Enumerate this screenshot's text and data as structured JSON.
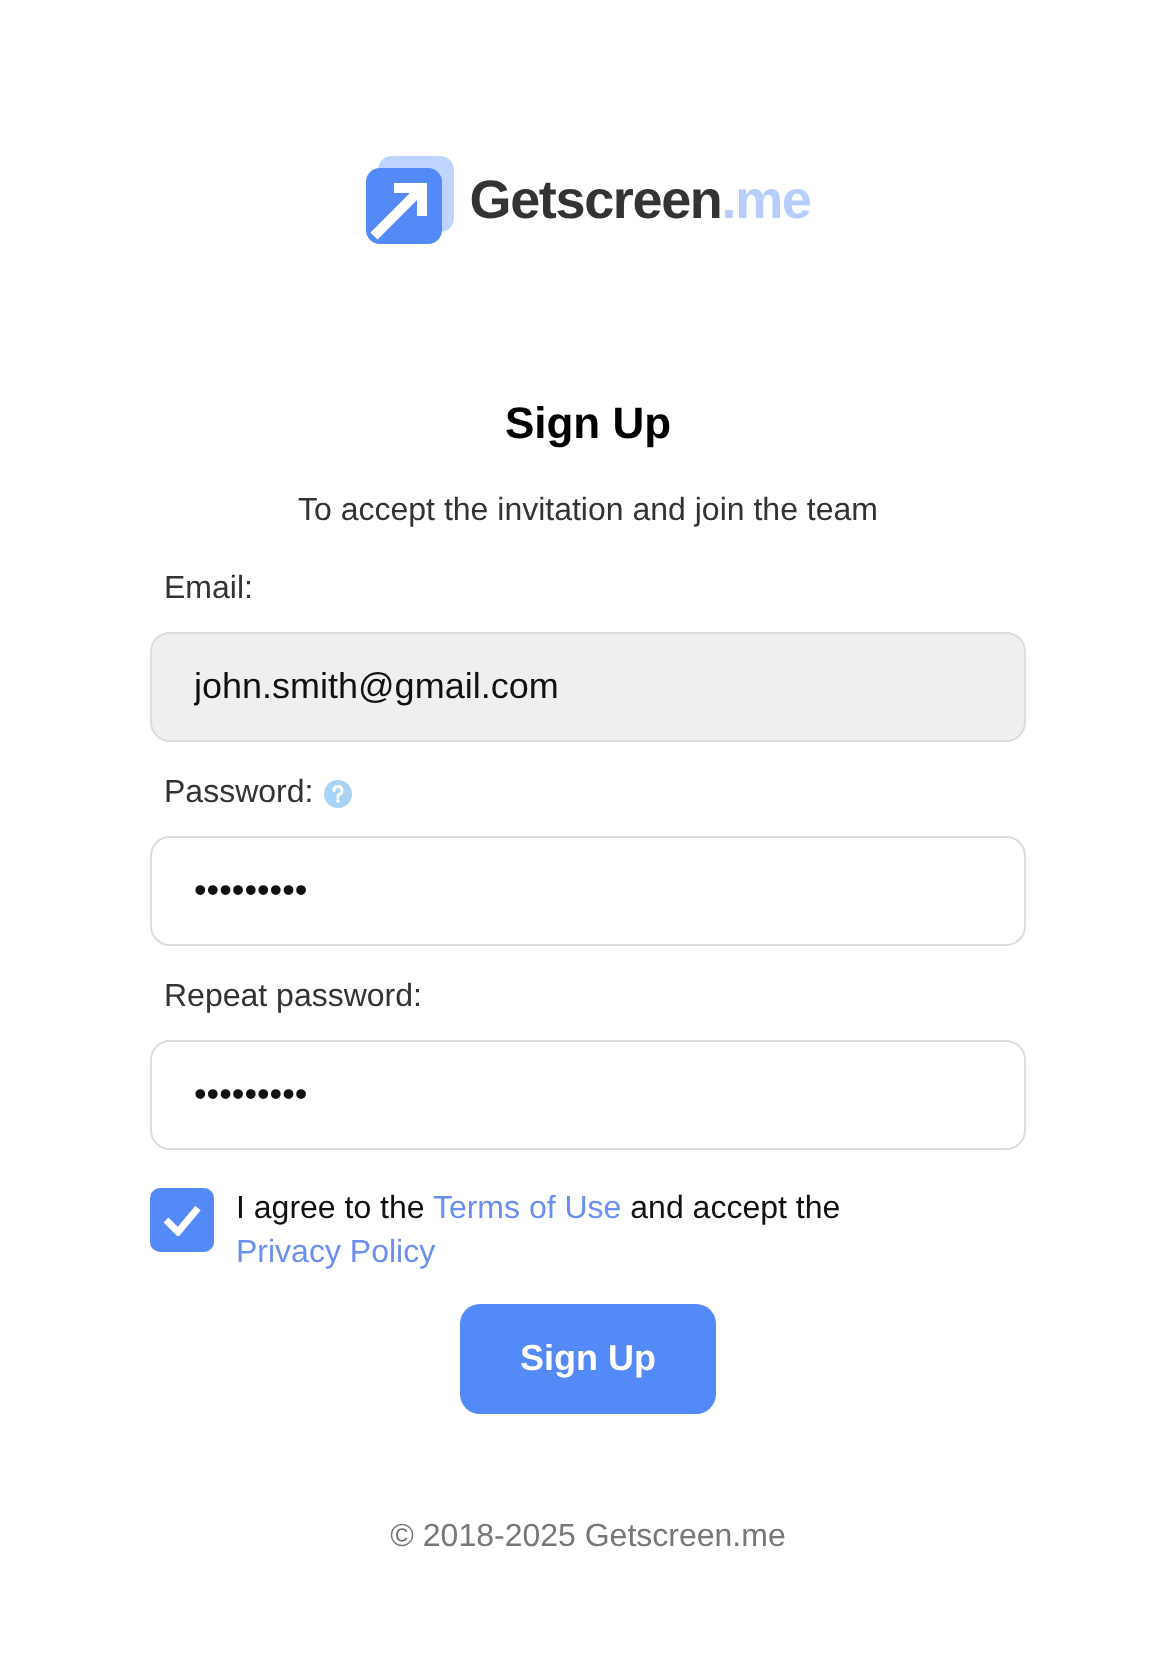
{
  "logo": {
    "name": "Getscreen",
    "suffix": ".me"
  },
  "title": "Sign Up",
  "subtitle": "To accept the invitation and join the team",
  "fields": [
    {
      "label": "Email:",
      "value": "john.smith@gmail.com",
      "disabled": true,
      "help": false
    },
    {
      "label": "Password:",
      "value": "•••••••••",
      "disabled": false,
      "help": true
    },
    {
      "label": "Repeat password:",
      "value": "•••••••••",
      "disabled": false,
      "help": false
    }
  ],
  "agreement": {
    "checked": true,
    "parts": [
      {
        "kind": "text",
        "text": "I agree to the "
      },
      {
        "kind": "link",
        "text": "Terms of Use"
      },
      {
        "kind": "text",
        "text": " and accept the "
      },
      {
        "kind": "link",
        "text": "Privacy Policy"
      }
    ]
  },
  "submit": "Sign Up",
  "footer": "© 2018-2025 Getscreen.me"
}
